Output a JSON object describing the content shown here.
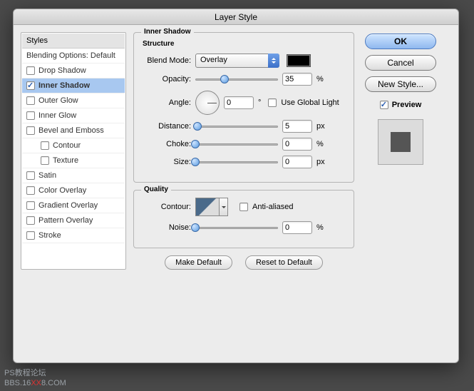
{
  "window": {
    "title": "Layer Style"
  },
  "styles": {
    "header": "Styles",
    "blending": "Blending Options: Default",
    "items": [
      "Drop Shadow",
      "Inner Shadow",
      "Outer Glow",
      "Inner Glow",
      "Bevel and Emboss",
      "Contour",
      "Texture",
      "Satin",
      "Color Overlay",
      "Gradient Overlay",
      "Pattern Overlay",
      "Stroke"
    ]
  },
  "effect": {
    "panel_title": "Inner Shadow",
    "structure_label": "Structure",
    "blend_mode_label": "Blend Mode:",
    "blend_mode_value": "Overlay",
    "color": "#000000",
    "opacity_label": "Opacity:",
    "opacity_value": "35",
    "opacity_unit": "%",
    "angle_label": "Angle:",
    "angle_value": "0",
    "angle_unit": "°",
    "global_light_label": "Use Global Light",
    "distance_label": "Distance:",
    "distance_value": "5",
    "distance_unit": "px",
    "choke_label": "Choke:",
    "choke_value": "0",
    "choke_unit": "%",
    "size_label": "Size:",
    "size_value": "0",
    "size_unit": "px",
    "quality_label": "Quality",
    "contour_label": "Contour:",
    "anti_alias_label": "Anti-aliased",
    "noise_label": "Noise:",
    "noise_value": "0",
    "noise_unit": "%",
    "make_default": "Make Default",
    "reset_default": "Reset to Default"
  },
  "buttons": {
    "ok": "OK",
    "cancel": "Cancel",
    "new_style": "New Style..."
  },
  "preview": {
    "label": "Preview"
  },
  "watermark": {
    "line1": "PS教程论坛",
    "prefix": "BBS.16",
    "xx": "XX",
    "suffix": "8.COM"
  }
}
